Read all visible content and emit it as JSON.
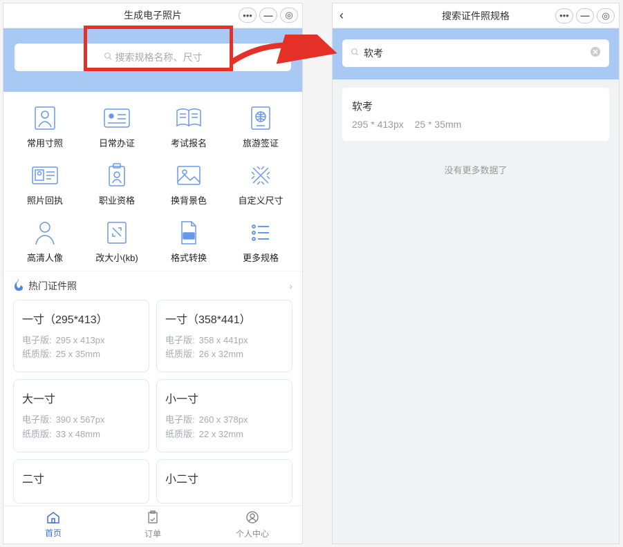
{
  "left": {
    "title": "生成电子照片",
    "search_placeholder": "搜索规格名称、尺寸",
    "categories": [
      {
        "label": "常用寸照"
      },
      {
        "label": "日常办证"
      },
      {
        "label": "考试报名"
      },
      {
        "label": "旅游签证"
      },
      {
        "label": "照片回执"
      },
      {
        "label": "职业资格"
      },
      {
        "label": "换背景色"
      },
      {
        "label": "自定义尺寸"
      },
      {
        "label": "高清人像"
      },
      {
        "label": "改大小(kb)"
      },
      {
        "label": "格式转换"
      },
      {
        "label": "更多规格"
      }
    ],
    "hot_label": "热门证件照",
    "specs": [
      {
        "title": "一寸（295*413）",
        "digital_k": "电子版:",
        "digital_v": "295 x 413px",
        "print_k": "纸质版:",
        "print_v": "25 x 35mm"
      },
      {
        "title": "一寸（358*441）",
        "digital_k": "电子版:",
        "digital_v": "358 x 441px",
        "print_k": "纸质版:",
        "print_v": "26 x 32mm"
      },
      {
        "title": "大一寸",
        "digital_k": "电子版:",
        "digital_v": "390 x 567px",
        "print_k": "纸质版:",
        "print_v": "33 x 48mm"
      },
      {
        "title": "小一寸",
        "digital_k": "电子版:",
        "digital_v": "260 x 378px",
        "print_k": "纸质版:",
        "print_v": "22 x 32mm"
      },
      {
        "title": "二寸",
        "digital_k": "",
        "digital_v": "",
        "print_k": "",
        "print_v": ""
      },
      {
        "title": "小二寸",
        "digital_k": "",
        "digital_v": "",
        "print_k": "",
        "print_v": ""
      }
    ],
    "tabs": {
      "home": "首页",
      "orders": "订单",
      "profile": "个人中心"
    }
  },
  "right": {
    "title": "搜索证件照规格",
    "search_value": "软考",
    "result": {
      "title": "软考",
      "dim_px": "295 * 413px",
      "dim_mm": "25 * 35mm"
    },
    "no_more": "没有更多数据了"
  }
}
